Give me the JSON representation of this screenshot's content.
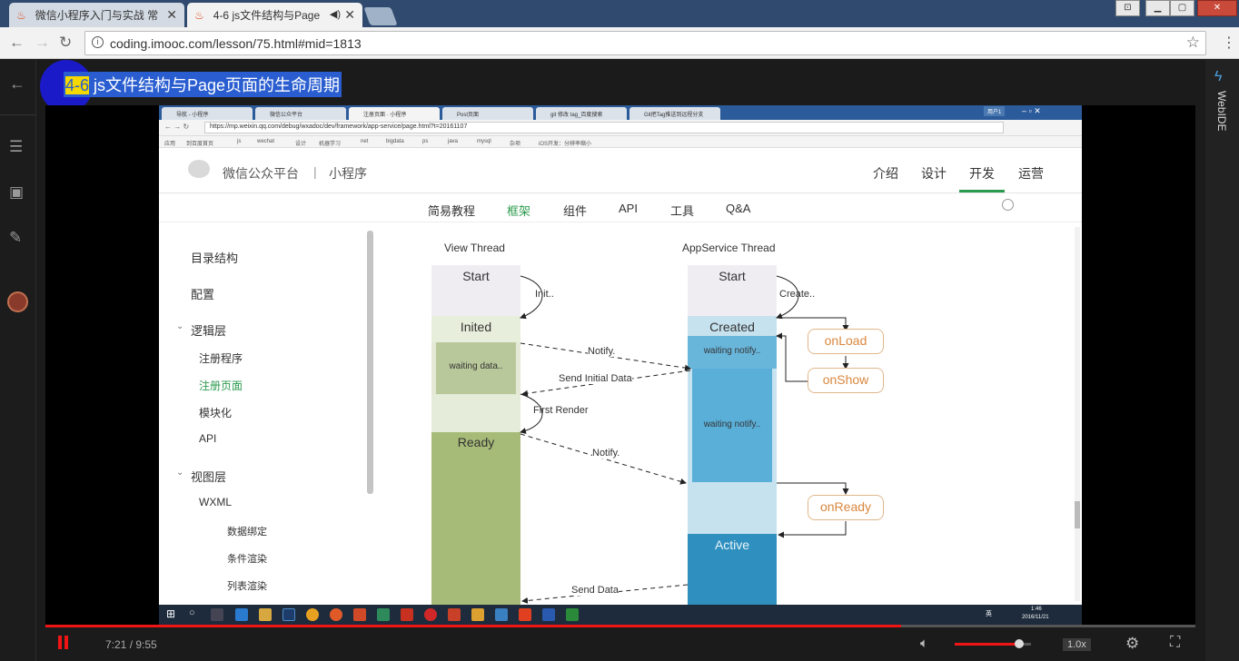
{
  "browser": {
    "tabs": [
      {
        "label": "微信小程序入门与实战 常"
      },
      {
        "label": "4-6 js文件结构与Page"
      }
    ],
    "url": "coding.imooc.com/lesson/75.html#mid=1813"
  },
  "lesson": {
    "title_number": "4-6",
    "title_text": " js文件结构与Page页面的生命周期"
  },
  "right_rail": {
    "label": "WebIDE"
  },
  "video": {
    "inner_browser": {
      "tabs": [
        "导航 - 小程序",
        "微信公众平台",
        "注册页面 · 小程序",
        "Post页面",
        "git 修改 tag_百度搜索",
        "Git把Tag推送到远程分支"
      ],
      "url": "https://mp.weixin.qq.com/debug/wxadoc/dev/framework/app-service/page.html?t=20161107",
      "bookmarks": [
        "应用",
        "到百度首页",
        "js",
        "wechat",
        "设计",
        "机器学习",
        "net",
        "bigdata",
        "ps",
        "java",
        "mysql",
        "杂项",
        "iOS开发：分辨率缩小"
      ],
      "user": "用户1"
    },
    "wx_header": {
      "brand": "微信公众平台",
      "separator": "|",
      "product": "小程序",
      "nav": [
        "介绍",
        "设计",
        "开发",
        "运营"
      ],
      "active_nav": "开发"
    },
    "sub_nav": {
      "items": [
        "简易教程",
        "框架",
        "组件",
        "API",
        "工具",
        "Q&A"
      ],
      "active": "框架"
    },
    "doc_menu": {
      "items": [
        {
          "label": "目录结构",
          "level": 1
        },
        {
          "label": "配置",
          "level": 1
        },
        {
          "label": "逻辑层",
          "level": 1,
          "expanded": true
        },
        {
          "label": "注册程序",
          "level": 2
        },
        {
          "label": "注册页面",
          "level": 2,
          "active": true
        },
        {
          "label": "模块化",
          "level": 2
        },
        {
          "label": "API",
          "level": 2
        },
        {
          "label": "视图层",
          "level": 1,
          "expanded": true
        },
        {
          "label": "WXML",
          "level": 2
        },
        {
          "label": "数据绑定",
          "level": 3
        },
        {
          "label": "条件渲染",
          "level": 3
        },
        {
          "label": "列表渲染",
          "level": 3
        }
      ]
    },
    "diagram": {
      "view_thread": "View Thread",
      "app_thread": "AppService Thread",
      "view_blocks": [
        "Start",
        "Inited",
        "waiting data..",
        "Ready"
      ],
      "app_blocks": [
        "Start",
        "Created",
        "waiting notify..",
        "waiting notify..",
        "Active"
      ],
      "arrows": [
        "Init..",
        "Create..",
        "Notify.",
        "Send Initial Data",
        "First Render",
        "Notify.",
        "Send Data"
      ],
      "lifecycle": [
        "onLoad",
        "onShow",
        "onReady"
      ]
    },
    "taskbar": {
      "time": "1:46",
      "date": "2016/11/21",
      "ime": "英"
    }
  },
  "player": {
    "time": "7:21 / 9:55",
    "progress": 0.744,
    "volume": 0.85,
    "speed": "1.0x"
  }
}
